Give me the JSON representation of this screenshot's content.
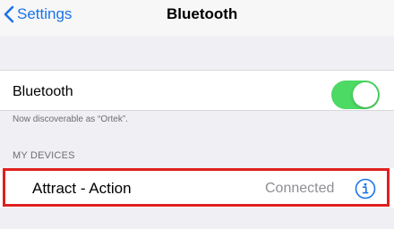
{
  "nav": {
    "back_label": "Settings",
    "title": "Bluetooth"
  },
  "bluetooth": {
    "label": "Bluetooth",
    "toggle_on": true,
    "discoverable_text": "Now discoverable as “Ortek”."
  },
  "my_devices": {
    "header": "MY DEVICES",
    "items": [
      {
        "name": "Attract - Action",
        "status": "Connected",
        "icon": "info-icon"
      }
    ]
  },
  "colors": {
    "accent": "#1a73e8",
    "toggle_on": "#4cd964",
    "highlight": "#e02020"
  }
}
